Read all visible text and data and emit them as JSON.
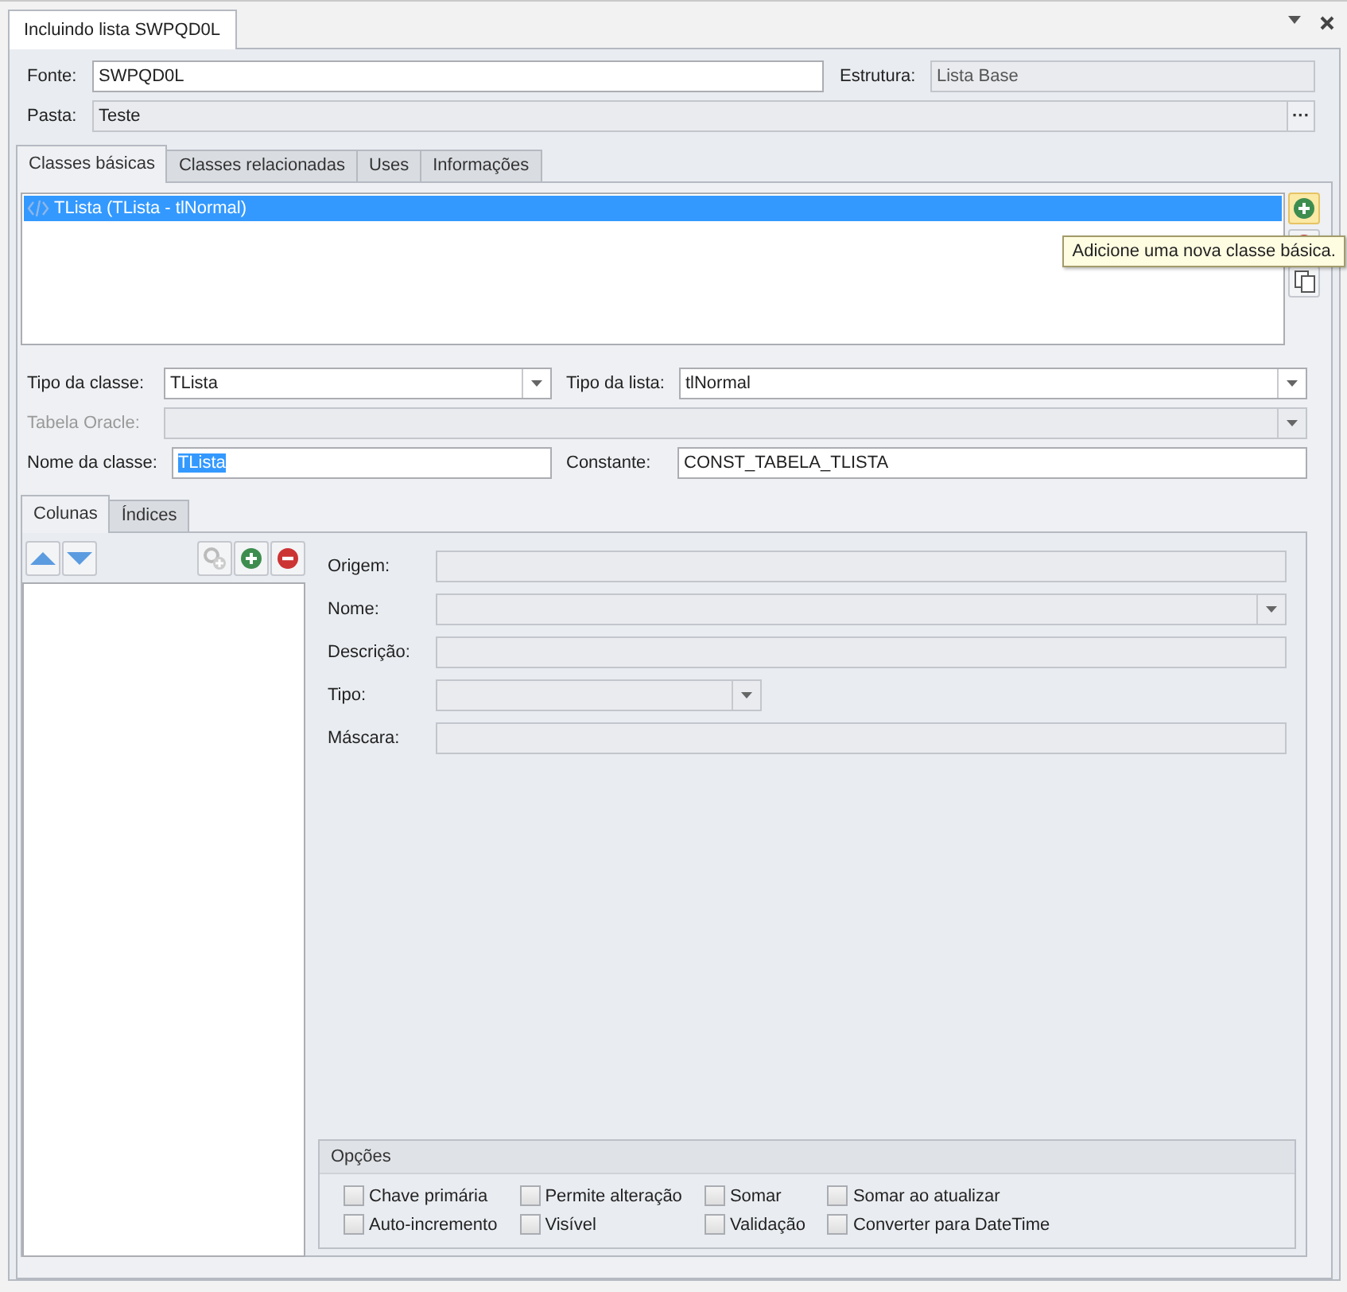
{
  "document_tab": {
    "title": "Incluindo lista SWPQD0L",
    "selected": true
  },
  "header": {
    "fonte": {
      "label": "Fonte:",
      "value": "SWPQD0L",
      "disabled": false
    },
    "estrutura": {
      "label": "Estrutura:",
      "value": "Lista Base",
      "disabled": true
    },
    "pasta": {
      "label": "Pasta:",
      "value": "Teste",
      "disabled": true,
      "button": "···"
    }
  },
  "tabs": [
    {
      "label": "Classes básicas",
      "selected": true
    },
    {
      "label": "Classes relacionadas",
      "selected": false
    },
    {
      "label": "Uses",
      "selected": false
    },
    {
      "label": "Informações",
      "selected": false
    }
  ],
  "classes_list": [
    {
      "label": "TLista (TLista - tlNormal)",
      "selected": true
    }
  ],
  "tooltip": "Adicione uma nova classe básica.",
  "class_form": [
    {
      "fields": [
        {
          "label": "Tipo da classe:",
          "kind": "combo",
          "value": "TLista",
          "disabled": false
        },
        {
          "label": "Tipo da lista:",
          "kind": "combo",
          "value": "tlNormal",
          "disabled": false
        }
      ]
    },
    {
      "fields": [
        {
          "label": "Tabela Oracle:",
          "kind": "combo",
          "disabled": true
        }
      ]
    },
    {
      "fields": [
        {
          "label": "Nome da classe:",
          "kind": "text",
          "value": "TLista",
          "disabled": false,
          "text_selected": true
        },
        {
          "label": "Constante:",
          "kind": "text",
          "value": "CONST_TABELA_TLISTA",
          "disabled": false,
          "text_selected": false
        }
      ]
    }
  ],
  "inner_tabs": [
    {
      "label": "Colunas",
      "selected": true
    },
    {
      "label": "Índices",
      "selected": false
    }
  ],
  "column_fields": [
    {
      "label": "Origem:",
      "kind": "text",
      "disabled": true
    },
    {
      "label": "Nome:",
      "kind": "combo",
      "disabled": true
    },
    {
      "label": "Descrição:",
      "kind": "text",
      "disabled": true
    },
    {
      "label": "Tipo:",
      "kind": "short-combo",
      "disabled": true
    },
    {
      "label": "Máscara:",
      "kind": "text",
      "disabled": true
    }
  ],
  "options": {
    "title": "Opções",
    "checkboxes": [
      {
        "label": "Chave primária",
        "checked": false
      },
      {
        "label": "Auto-incremento",
        "checked": false
      },
      {
        "label": "Permite alteração",
        "checked": false
      },
      {
        "label": "Visível",
        "checked": false
      },
      {
        "label": "Somar",
        "checked": false
      },
      {
        "label": "Validação",
        "checked": false
      },
      {
        "label": "Somar ao atualizar",
        "checked": false
      },
      {
        "label": "Converter para DateTime",
        "checked": false
      }
    ]
  }
}
